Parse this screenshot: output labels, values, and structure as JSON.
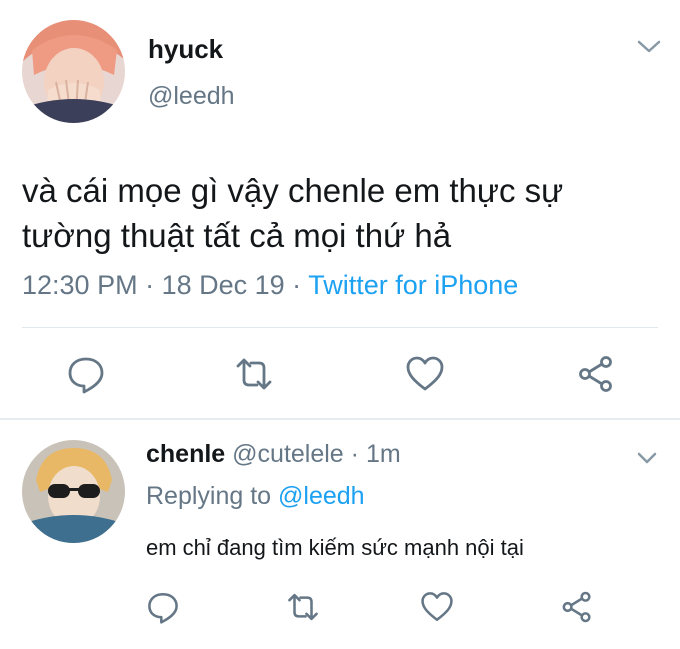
{
  "main_tweet": {
    "name": "hyuck",
    "handle": "@leedh",
    "text": "và cái mọe gì vậy chenle em thực sự tường thuật tất cả mọi thứ hả",
    "time": "12:30 PM",
    "date": "18 Dec 19",
    "separator": " · ",
    "source": "Twitter for iPhone",
    "actions": [
      "reply-icon",
      "retweet-icon",
      "like-icon",
      "share-icon"
    ]
  },
  "reply_tweet": {
    "name": "chenle",
    "handle": "@cutelele",
    "age": "1m",
    "dot": " · ",
    "replying_prefix": "Replying to ",
    "replying_to": "@leedh",
    "text": "em chỉ đang tìm kiếm sức mạnh nội tại",
    "actions": [
      "reply-icon",
      "retweet-icon",
      "like-icon",
      "share-icon"
    ]
  },
  "colors": {
    "text": "#14171a",
    "secondary": "#657786",
    "link": "#1da1f2",
    "separator": "#e1e8ed"
  }
}
